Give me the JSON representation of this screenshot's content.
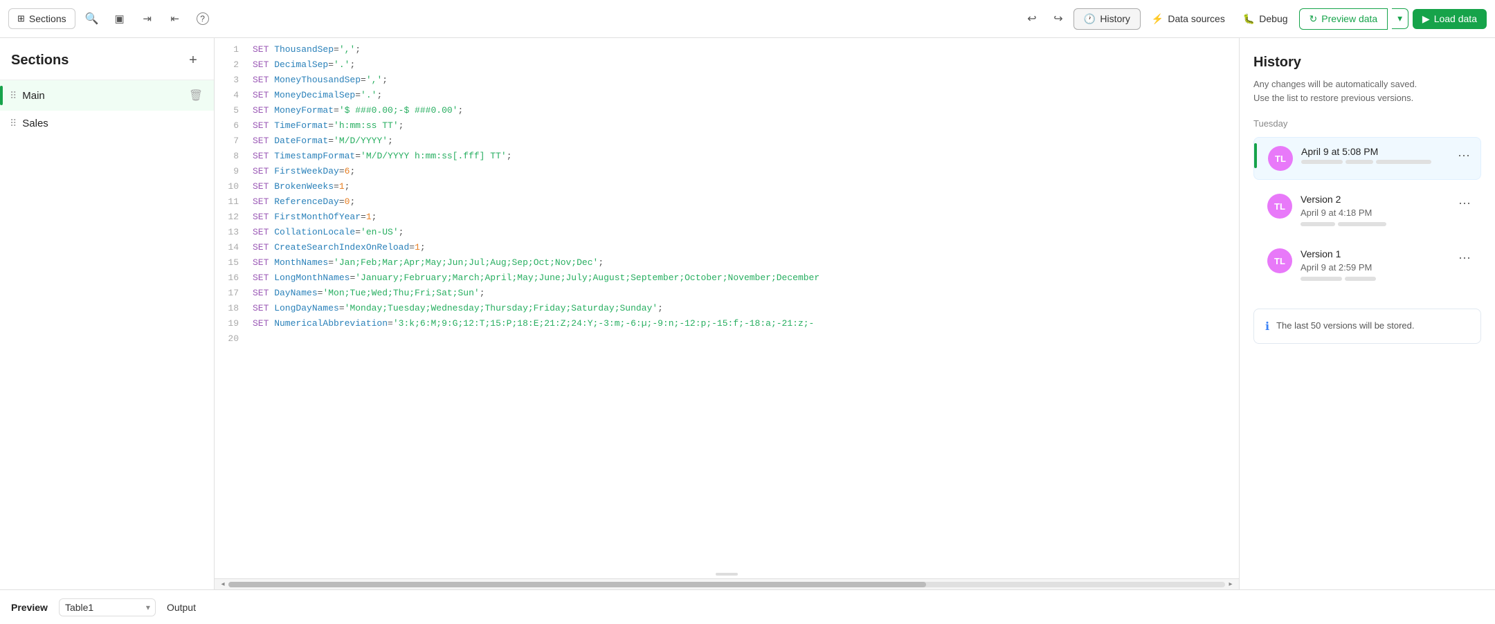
{
  "toolbar": {
    "sections_label": "Sections",
    "history_label": "History",
    "data_sources_label": "Data sources",
    "debug_label": "Debug",
    "preview_data_label": "Preview data",
    "load_data_label": "Load data",
    "undo_title": "Undo",
    "redo_title": "Redo"
  },
  "sidebar": {
    "title": "Sections",
    "add_tooltip": "+",
    "items": [
      {
        "id": "main",
        "label": "Main",
        "active": true
      },
      {
        "id": "sales",
        "label": "Sales",
        "active": false
      }
    ]
  },
  "editor": {
    "lines": [
      {
        "num": 1,
        "content": "SET ThousandSep=',';",
        "tokens": [
          {
            "type": "kw",
            "text": "SET"
          },
          {
            "type": "fn",
            "text": " ThousandSep"
          },
          {
            "type": "plain",
            "text": "="
          },
          {
            "type": "str",
            "text": "','"
          },
          {
            "type": "plain",
            "text": ";"
          }
        ]
      },
      {
        "num": 2,
        "content": "SET DecimalSep='.';",
        "tokens": [
          {
            "type": "kw",
            "text": "SET"
          },
          {
            "type": "fn",
            "text": " DecimalSep"
          },
          {
            "type": "plain",
            "text": "="
          },
          {
            "type": "str",
            "text": "'.'"
          },
          {
            "type": "plain",
            "text": ";"
          }
        ]
      },
      {
        "num": 3,
        "content": "SET MoneyThousandSep=',';",
        "tokens": [
          {
            "type": "kw",
            "text": "SET"
          },
          {
            "type": "fn",
            "text": " MoneyThousandSep"
          },
          {
            "type": "plain",
            "text": "="
          },
          {
            "type": "str",
            "text": "','"
          },
          {
            "type": "plain",
            "text": ";"
          }
        ]
      },
      {
        "num": 4,
        "content": "SET MoneyDecimalSep='.';",
        "tokens": [
          {
            "type": "kw",
            "text": "SET"
          },
          {
            "type": "fn",
            "text": " MoneyDecimalSep"
          },
          {
            "type": "plain",
            "text": "="
          },
          {
            "type": "str",
            "text": "'.'"
          },
          {
            "type": "plain",
            "text": ";"
          }
        ]
      },
      {
        "num": 5,
        "content": "SET MoneyFormat='$ ###0.00;-$ ###0.00';",
        "tokens": [
          {
            "type": "kw",
            "text": "SET"
          },
          {
            "type": "fn",
            "text": " MoneyFormat"
          },
          {
            "type": "plain",
            "text": "="
          },
          {
            "type": "str",
            "text": "'$ ###0.00;-$ ###0.00'"
          },
          {
            "type": "plain",
            "text": ";"
          }
        ]
      },
      {
        "num": 6,
        "content": "SET TimeFormat='h:mm:ss TT';",
        "tokens": [
          {
            "type": "kw",
            "text": "SET"
          },
          {
            "type": "fn",
            "text": " TimeFormat"
          },
          {
            "type": "plain",
            "text": "="
          },
          {
            "type": "str",
            "text": "'h:mm:ss TT'"
          },
          {
            "type": "plain",
            "text": ";"
          }
        ]
      },
      {
        "num": 7,
        "content": "SET DateFormat='M/D/YYYY';",
        "tokens": [
          {
            "type": "kw",
            "text": "SET"
          },
          {
            "type": "fn",
            "text": " DateFormat"
          },
          {
            "type": "plain",
            "text": "="
          },
          {
            "type": "str",
            "text": "'M/D/YYYY'"
          },
          {
            "type": "plain",
            "text": ";"
          }
        ]
      },
      {
        "num": 8,
        "content": "SET TimestampFormat='M/D/YYYY h:mm:ss[.fff] TT';",
        "tokens": [
          {
            "type": "kw",
            "text": "SET"
          },
          {
            "type": "fn",
            "text": " TimestampFormat"
          },
          {
            "type": "plain",
            "text": "="
          },
          {
            "type": "str",
            "text": "'M/D/YYYY h:mm:ss[.fff] TT'"
          },
          {
            "type": "plain",
            "text": ";"
          }
        ]
      },
      {
        "num": 9,
        "content": "SET FirstWeekDay=6;",
        "tokens": [
          {
            "type": "kw",
            "text": "SET"
          },
          {
            "type": "fn",
            "text": " FirstWeekDay"
          },
          {
            "type": "plain",
            "text": "="
          },
          {
            "type": "num",
            "text": "6"
          },
          {
            "type": "plain",
            "text": ";"
          }
        ]
      },
      {
        "num": 10,
        "content": "SET BrokenWeeks=1;",
        "tokens": [
          {
            "type": "kw",
            "text": "SET"
          },
          {
            "type": "fn",
            "text": " BrokenWeeks"
          },
          {
            "type": "plain",
            "text": "="
          },
          {
            "type": "num",
            "text": "1"
          },
          {
            "type": "plain",
            "text": ";"
          }
        ]
      },
      {
        "num": 11,
        "content": "SET ReferenceDay=0;",
        "tokens": [
          {
            "type": "kw",
            "text": "SET"
          },
          {
            "type": "fn",
            "text": " ReferenceDay"
          },
          {
            "type": "plain",
            "text": "="
          },
          {
            "type": "num",
            "text": "0"
          },
          {
            "type": "plain",
            "text": ";"
          }
        ]
      },
      {
        "num": 12,
        "content": "SET FirstMonthOfYear=1;",
        "tokens": [
          {
            "type": "kw",
            "text": "SET"
          },
          {
            "type": "fn",
            "text": " FirstMonthOfYear"
          },
          {
            "type": "plain",
            "text": "="
          },
          {
            "type": "num",
            "text": "1"
          },
          {
            "type": "plain",
            "text": ";"
          }
        ]
      },
      {
        "num": 13,
        "content": "SET CollationLocale='en-US';",
        "tokens": [
          {
            "type": "kw",
            "text": "SET"
          },
          {
            "type": "fn",
            "text": " CollationLocale"
          },
          {
            "type": "plain",
            "text": "="
          },
          {
            "type": "str",
            "text": "'en-US'"
          },
          {
            "type": "plain",
            "text": ";"
          }
        ]
      },
      {
        "num": 14,
        "content": "SET CreateSearchIndexOnReload=1;",
        "tokens": [
          {
            "type": "kw",
            "text": "SET"
          },
          {
            "type": "fn",
            "text": " CreateSearchIndexOnReload"
          },
          {
            "type": "plain",
            "text": "="
          },
          {
            "type": "num",
            "text": "1"
          },
          {
            "type": "plain",
            "text": ";"
          }
        ]
      },
      {
        "num": 15,
        "content": "SET MonthNames='Jan;Feb;Mar;Apr;May;Jun;Jul;Aug;Sep;Oct;Nov;Dec';",
        "tokens": [
          {
            "type": "kw",
            "text": "SET"
          },
          {
            "type": "fn",
            "text": " MonthNames"
          },
          {
            "type": "plain",
            "text": "="
          },
          {
            "type": "str",
            "text": "'Jan;Feb;Mar;Apr;May;Jun;Jul;Aug;Sep;Oct;Nov;Dec'"
          },
          {
            "type": "plain",
            "text": ";"
          }
        ]
      },
      {
        "num": 16,
        "content": "SET LongMonthNames='January;February;March;April;May;June;July;August;September;October;November;December",
        "tokens": [
          {
            "type": "kw",
            "text": "SET"
          },
          {
            "type": "fn",
            "text": " LongMonthNames"
          },
          {
            "type": "plain",
            "text": "="
          },
          {
            "type": "str",
            "text": "'January;February;March;April;May;June;July;August;September;October;November;December"
          }
        ]
      },
      {
        "num": 17,
        "content": "SET DayNames='Mon;Tue;Wed;Thu;Fri;Sat;Sun';",
        "tokens": [
          {
            "type": "kw",
            "text": "SET"
          },
          {
            "type": "fn",
            "text": " DayNames"
          },
          {
            "type": "plain",
            "text": "="
          },
          {
            "type": "str",
            "text": "'Mon;Tue;Wed;Thu;Fri;Sat;Sun'"
          },
          {
            "type": "plain",
            "text": ";"
          }
        ]
      },
      {
        "num": 18,
        "content": "SET LongDayNames='Monday;Tuesday;Wednesday;Thursday;Friday;Saturday;Sunday';",
        "tokens": [
          {
            "type": "kw",
            "text": "SET"
          },
          {
            "type": "fn",
            "text": " LongDayNames"
          },
          {
            "type": "plain",
            "text": "="
          },
          {
            "type": "str",
            "text": "'Monday;Tuesday;Wednesday;Thursday;Friday;Saturday;Sunday'"
          },
          {
            "type": "plain",
            "text": ";"
          }
        ]
      },
      {
        "num": 19,
        "content": "SET NumericalAbbreviation='3:k;6:M;9:G;12:T;15:P;18:E;21:Z;24:Y;-3:m;-6:µ;-9:n;-12:p;-15:f;-18:a;-21:z;-",
        "tokens": [
          {
            "type": "kw",
            "text": "SET"
          },
          {
            "type": "fn",
            "text": " NumericalAbbreviation"
          },
          {
            "type": "plain",
            "text": "="
          },
          {
            "type": "str",
            "text": "'3:k;6:M;9:G;12:T;15:P;18:E;21:Z;24:Y;-3:m;-6:µ;-9:n;-12:p;-15:f;-18:a;-21:z;-"
          }
        ]
      },
      {
        "num": 20,
        "content": "",
        "tokens": []
      }
    ]
  },
  "history": {
    "title": "History",
    "description_line1": "Any changes will be automatically saved.",
    "description_line2": "Use the list to restore previous versions.",
    "day_label": "Tuesday",
    "versions": [
      {
        "id": "current",
        "label": "April 9 at 5:08 PM",
        "is_current": true,
        "avatar_initials": "TL",
        "bars": [
          60,
          40,
          80
        ]
      },
      {
        "id": "v2",
        "label": "Version 2",
        "subtitle": "April 9 at 4:18 PM",
        "is_current": false,
        "avatar_initials": "TL",
        "bars": [
          50,
          70
        ]
      },
      {
        "id": "v1",
        "label": "Version 1",
        "subtitle": "April 9 at 2:59 PM",
        "is_current": false,
        "avatar_initials": "TL",
        "bars": [
          60,
          45
        ]
      }
    ],
    "info_text": "The last 50 versions will be stored."
  },
  "bottom_bar": {
    "preview_label": "Preview",
    "table_value": "Table1",
    "output_label": "Output"
  }
}
